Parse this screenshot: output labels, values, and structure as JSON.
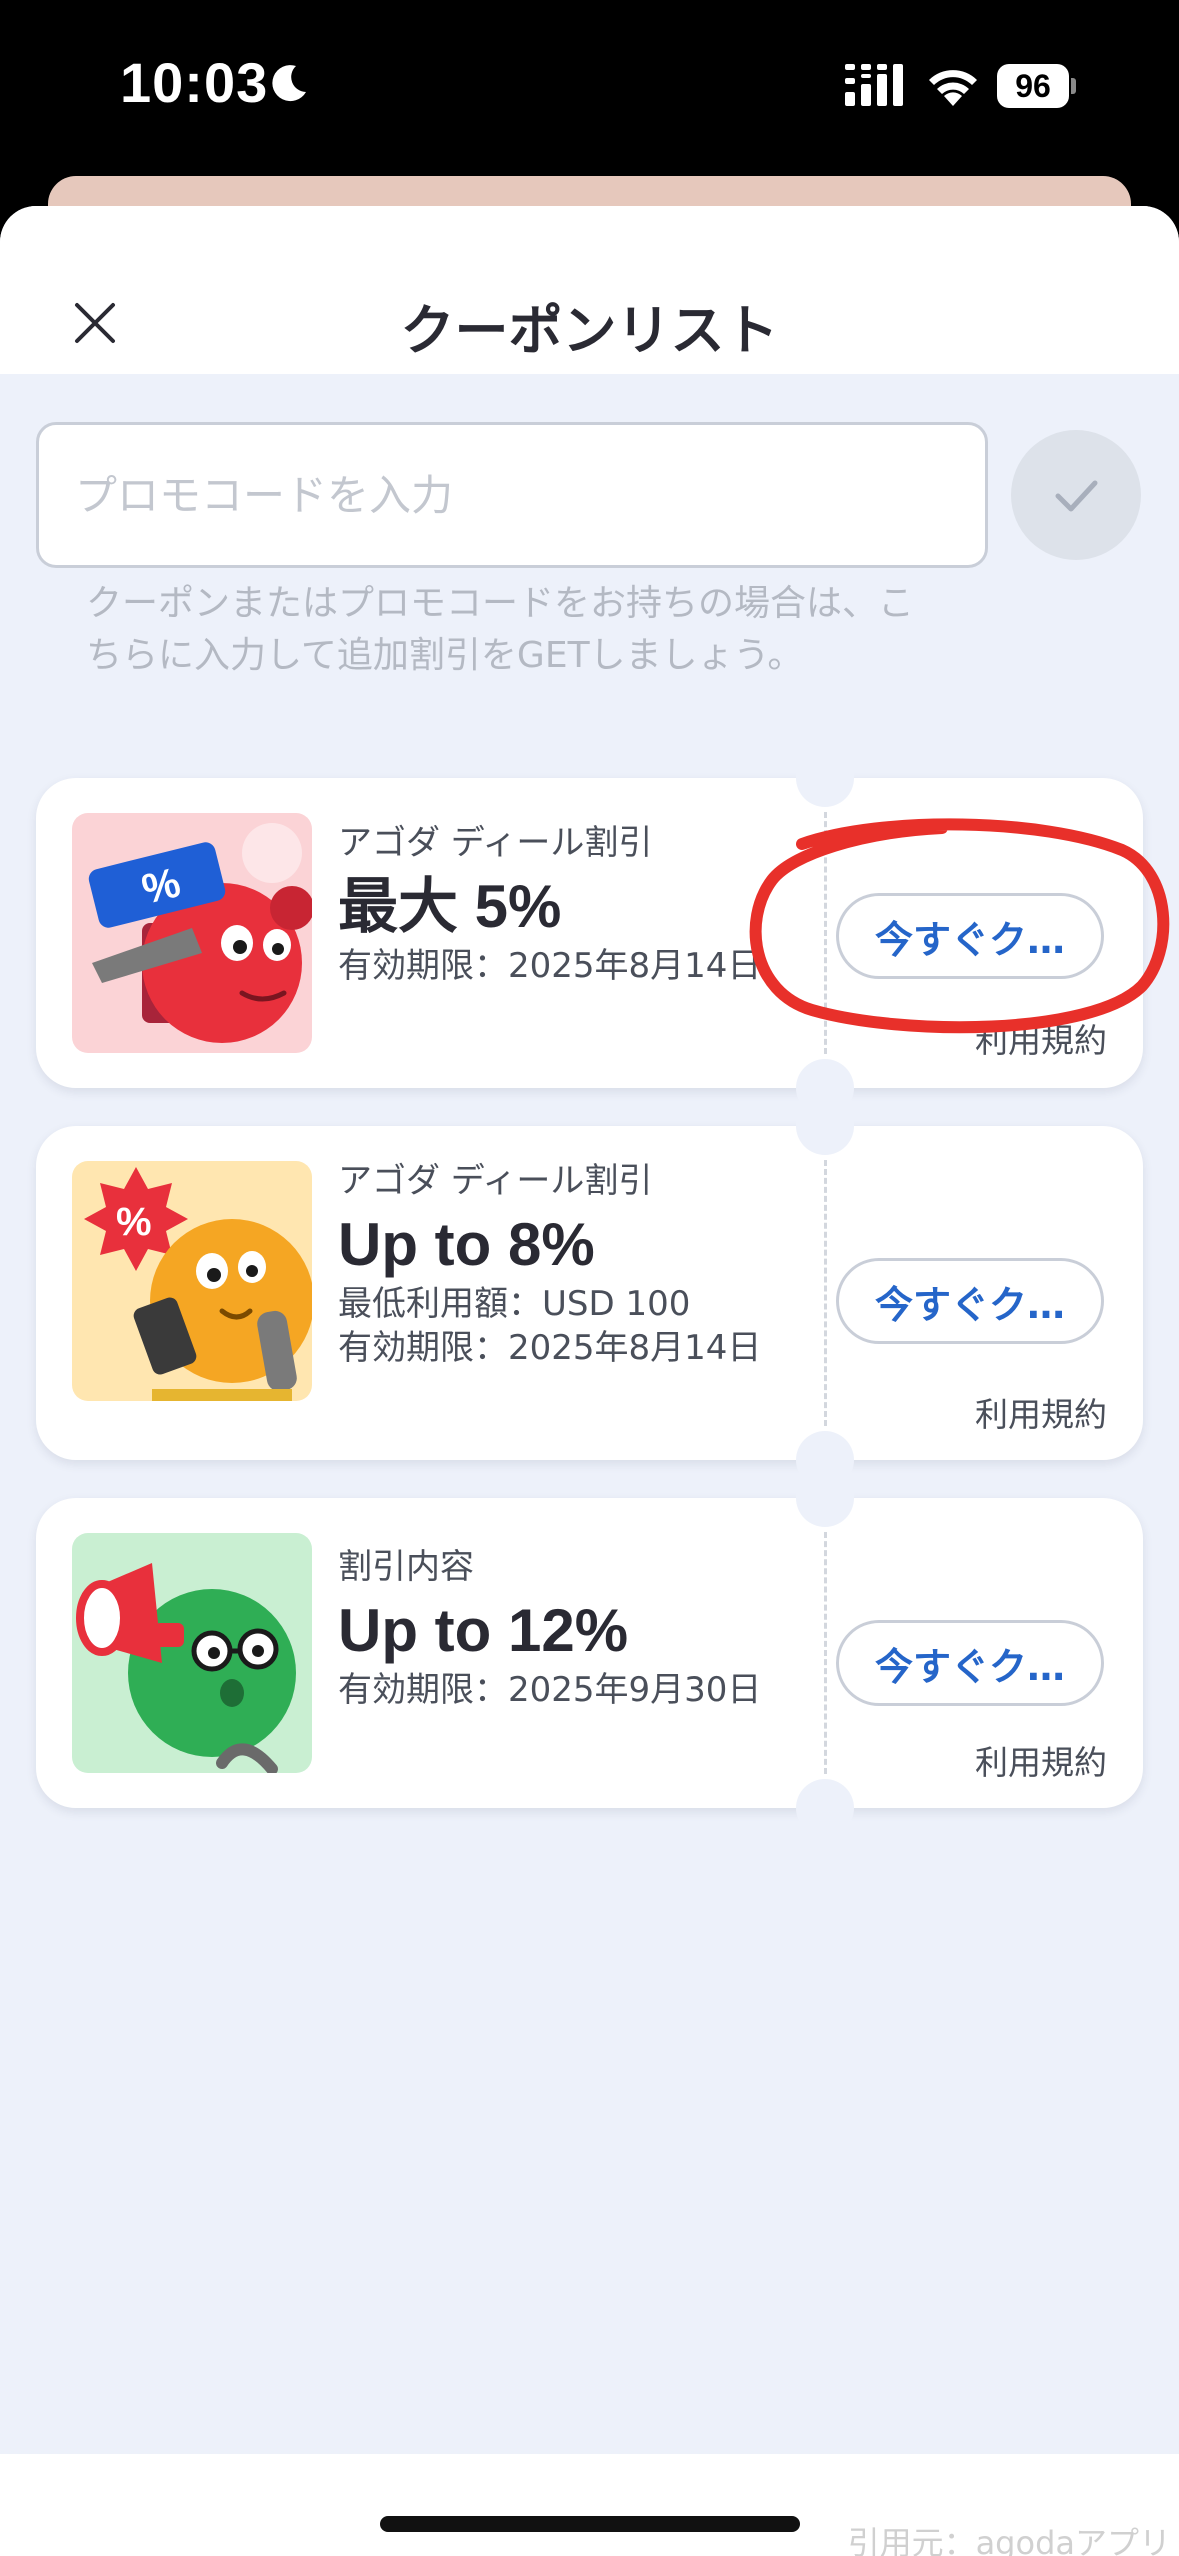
{
  "status_bar": {
    "time": "10:03",
    "battery": "96",
    "icons": [
      "moon-icon",
      "signal-icon",
      "wifi-icon",
      "battery-icon"
    ]
  },
  "sheet": {
    "title": "クーポンリスト",
    "close_icon": "close-icon"
  },
  "promo": {
    "placeholder": "プロモコードを入力",
    "value": "",
    "apply_icon": "check-icon",
    "help_text": "クーポンまたはプロモコードをお持ちの場合は、こちらに入力して追加割引をGETしましょう。"
  },
  "coupons": [
    {
      "category": "アゴダ ディール割引",
      "amount": "最大 5%",
      "min_spend": "",
      "expiry": "有効期限：2025年8月14日",
      "claim_label": "今すぐク…",
      "terms_label": "利用規約",
      "thumb_bg": "#fbd3d6",
      "mascot_color": "#e8303c",
      "highlighted": true
    },
    {
      "category": "アゴダ ディール割引",
      "amount": "Up to 8%",
      "min_spend": "最低利用額：USD 100",
      "expiry": "有効期限：2025年8月14日",
      "claim_label": "今すぐク…",
      "terms_label": "利用規約",
      "thumb_bg": "#ffe6b0",
      "mascot_color": "#f5a623",
      "highlighted": false
    },
    {
      "category": "割引内容",
      "amount": "Up to 12%",
      "min_spend": "",
      "expiry": "有効期限：2025年9月30日",
      "claim_label": "今すぐク…",
      "terms_label": "利用規約",
      "thumb_bg": "#c9efd2",
      "mascot_color": "#2fae55",
      "highlighted": false
    }
  ],
  "colors": {
    "accent_link": "#2565c9",
    "sheet_bg": "#edf1fa",
    "highlight": "#e8302a"
  },
  "footer": {
    "source_credit": "引用元：agodaアプリ"
  }
}
